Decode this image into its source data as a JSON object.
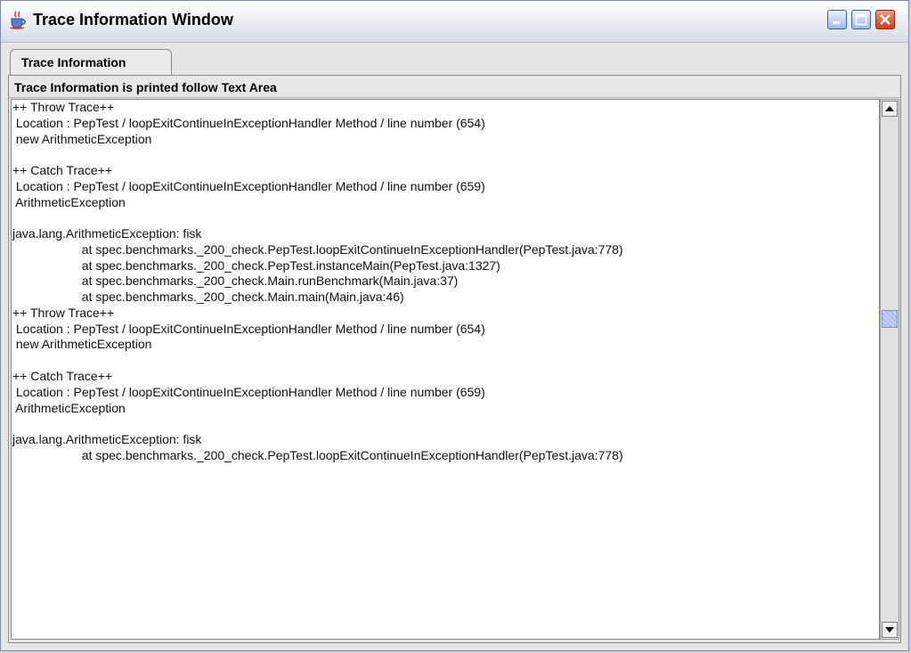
{
  "window": {
    "title": "Trace Information Window"
  },
  "tabs": [
    {
      "label": "Trace Information"
    }
  ],
  "panel": {
    "header": "Trace Information is printed follow Text Area"
  },
  "trace_lines": [
    "++ Throw Trace++",
    " Location : PepTest / loopExitContinueInExceptionHandler Method / line number (654)",
    " new ArithmeticException",
    "",
    "++ Catch Trace++",
    " Location : PepTest / loopExitContinueInExceptionHandler Method / line number (659)",
    " ArithmeticException",
    "",
    "java.lang.ArithmeticException: fisk",
    "                    at spec.benchmarks._200_check.PepTest.loopExitContinueInExceptionHandler(PepTest.java:778)",
    "                    at spec.benchmarks._200_check.PepTest.instanceMain(PepTest.java:1327)",
    "                    at spec.benchmarks._200_check.Main.runBenchmark(Main.java:37)",
    "                    at spec.benchmarks._200_check.Main.main(Main.java:46)",
    "++ Throw Trace++",
    " Location : PepTest / loopExitContinueInExceptionHandler Method / line number (654)",
    " new ArithmeticException",
    "",
    "++ Catch Trace++",
    " Location : PepTest / loopExitContinueInExceptionHandler Method / line number (659)",
    " ArithmeticException",
    "",
    "java.lang.ArithmeticException: fisk",
    "                    at spec.benchmarks._200_check.PepTest.loopExitContinueInExceptionHandler(PepTest.java:778)"
  ],
  "icons": {
    "app": "java-cup-icon",
    "minimize": "minimize-icon",
    "maximize": "maximize-icon",
    "close": "close-icon",
    "scroll_up": "arrow-up-icon",
    "scroll_down": "arrow-down-icon"
  },
  "colors": {
    "close_button": "#d2391c",
    "scroll_thumb": "#a9b8ec"
  }
}
